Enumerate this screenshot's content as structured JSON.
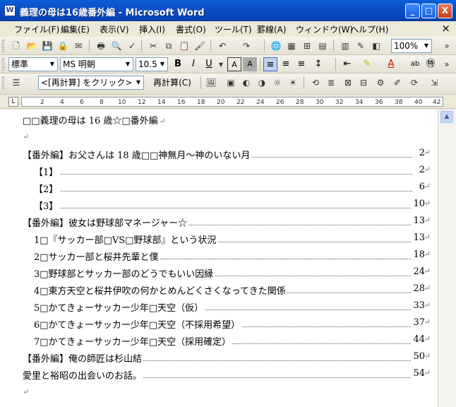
{
  "window": {
    "title": "義理の母は16歳番外編 - Microsoft Word",
    "icon_label": "W",
    "minimize": "_",
    "maximize": "□",
    "close": "X"
  },
  "menu": {
    "items": [
      "ファイル(F)",
      "編集(E)",
      "表示(V)",
      "挿入(I)",
      "書式(O)",
      "ツール(T)",
      "罫線(A)",
      "ウィンドウ(W)",
      "ヘルプ(H)"
    ],
    "close_doc": "×"
  },
  "standard_toolbar": {
    "zoom": "100%"
  },
  "format_toolbar": {
    "style": "標準",
    "font": "MS 明朝",
    "size": "10.5",
    "bold": "B",
    "italic": "I",
    "underline": "U"
  },
  "outline_toolbar": {
    "update_field": "<[再計算] をクリック>",
    "recalc": "再計算(C)"
  },
  "ruler": {
    "ticks": [
      "2",
      "4",
      "6",
      "8",
      "10",
      "12",
      "14",
      "16",
      "18",
      "20",
      "22",
      "24",
      "26",
      "28",
      "30",
      "32",
      "34",
      "36",
      "38",
      "40",
      "42"
    ]
  },
  "document": {
    "title": "□□義理の母は 16 歳☆□番外編",
    "toc": [
      {
        "text": "【番外編】お父さんは 18 歳□□神無月〜神のいない月",
        "page": "2",
        "indent": false
      },
      {
        "text": "【1】",
        "page": "2",
        "indent": true
      },
      {
        "text": "【2】",
        "page": "6",
        "indent": true
      },
      {
        "text": "【3】",
        "page": "10",
        "indent": true
      },
      {
        "text": "【番外編】彼女は野球部マネージャー☆",
        "page": "13",
        "indent": false
      },
      {
        "text": "1□『サッカー部□VS□野球部』という状況",
        "page": "13",
        "indent": true
      },
      {
        "text": "2□サッカー部と桜井先輩と僕",
        "page": "18",
        "indent": true
      },
      {
        "text": "3□野球部とサッカー部のどうでもいい因縁",
        "page": "24",
        "indent": true
      },
      {
        "text": "4□東方天空と桜井伊吹の何かとめんどくさくなってきた関係",
        "page": "28",
        "indent": true
      },
      {
        "text": "5□かてきょーサッカー少年□天空（仮）",
        "page": "33",
        "indent": true
      },
      {
        "text": "6□かてきょーサッカー少年□天空（不採用希望）",
        "page": "37",
        "indent": true
      },
      {
        "text": "7□かてきょーサッカー少年□天空（採用確定）",
        "page": "44",
        "indent": true
      },
      {
        "text": "【番外編】俺の師匠は杉山結",
        "page": "50",
        "indent": false
      },
      {
        "text": "愛里と裕昭の出会いのお話。",
        "page": "54",
        "indent": false
      }
    ]
  }
}
